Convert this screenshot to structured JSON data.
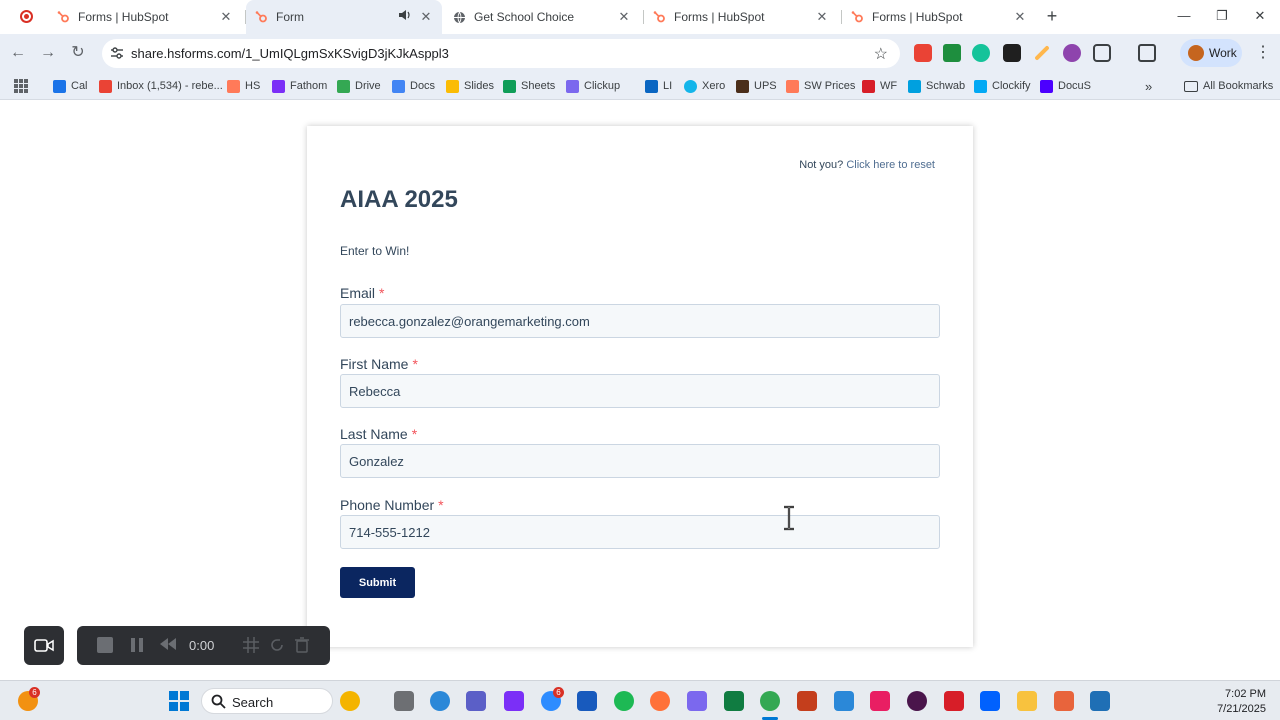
{
  "browser": {
    "tabs": [
      {
        "title": "Forms | HubSpot",
        "active": false
      },
      {
        "title": "Form",
        "active": true
      },
      {
        "title": "Get School Choice",
        "active": false
      },
      {
        "title": "Forms | HubSpot",
        "active": false
      },
      {
        "title": "Forms | HubSpot",
        "active": false
      }
    ],
    "url": "share.hsforms.com/1_UmIQLgmSxKSvigD3jKJkAsppl3",
    "profile_label": "Work",
    "all_bookmarks_label": "All Bookmarks",
    "bookmarks": [
      {
        "label": "Cal",
        "color": "#1a73e8"
      },
      {
        "label": "Inbox (1,534) - rebe...",
        "color": "#ea4335"
      },
      {
        "label": "HS",
        "color": "#ff7a59"
      },
      {
        "label": "Fathom",
        "color": "#7b2ff7"
      },
      {
        "label": "Drive",
        "color": "#34a853"
      },
      {
        "label": "Docs",
        "color": "#4285f4"
      },
      {
        "label": "Slides",
        "color": "#fbbc04"
      },
      {
        "label": "Sheets",
        "color": "#0f9d58"
      },
      {
        "label": "Clickup",
        "color": "#7b68ee"
      },
      {
        "label": "LI",
        "color": "#0a66c2"
      },
      {
        "label": "Xero",
        "color": "#13b5ea"
      },
      {
        "label": "UPS",
        "color": "#4b2e1a"
      },
      {
        "label": "SW Prices",
        "color": "#ff7a59"
      },
      {
        "label": "WF",
        "color": "#d71e28"
      },
      {
        "label": "Schwab",
        "color": "#00a0df"
      },
      {
        "label": "Clockify",
        "color": "#03a9f4"
      },
      {
        "label": "DocuS",
        "color": "#4c00ff"
      }
    ]
  },
  "form": {
    "not_you_text": "Not you?",
    "reset_link": "Click here to reset",
    "title": "AIAA 2025",
    "subtitle": "Enter to Win!",
    "fields": [
      {
        "label": "Email",
        "value": "rebecca.gonzalez@orangemarketing.com"
      },
      {
        "label": "First Name",
        "value": "Rebecca"
      },
      {
        "label": "Last Name",
        "value": "Gonzalez"
      },
      {
        "label": "Phone Number",
        "value": "714-555-1212"
      }
    ],
    "submit_label": "Submit"
  },
  "recorder": {
    "time": "0:00"
  },
  "taskbar": {
    "search_label": "Search",
    "time": "7:02 PM",
    "date": "7/21/2025",
    "badges": [
      "6",
      "6"
    ]
  }
}
